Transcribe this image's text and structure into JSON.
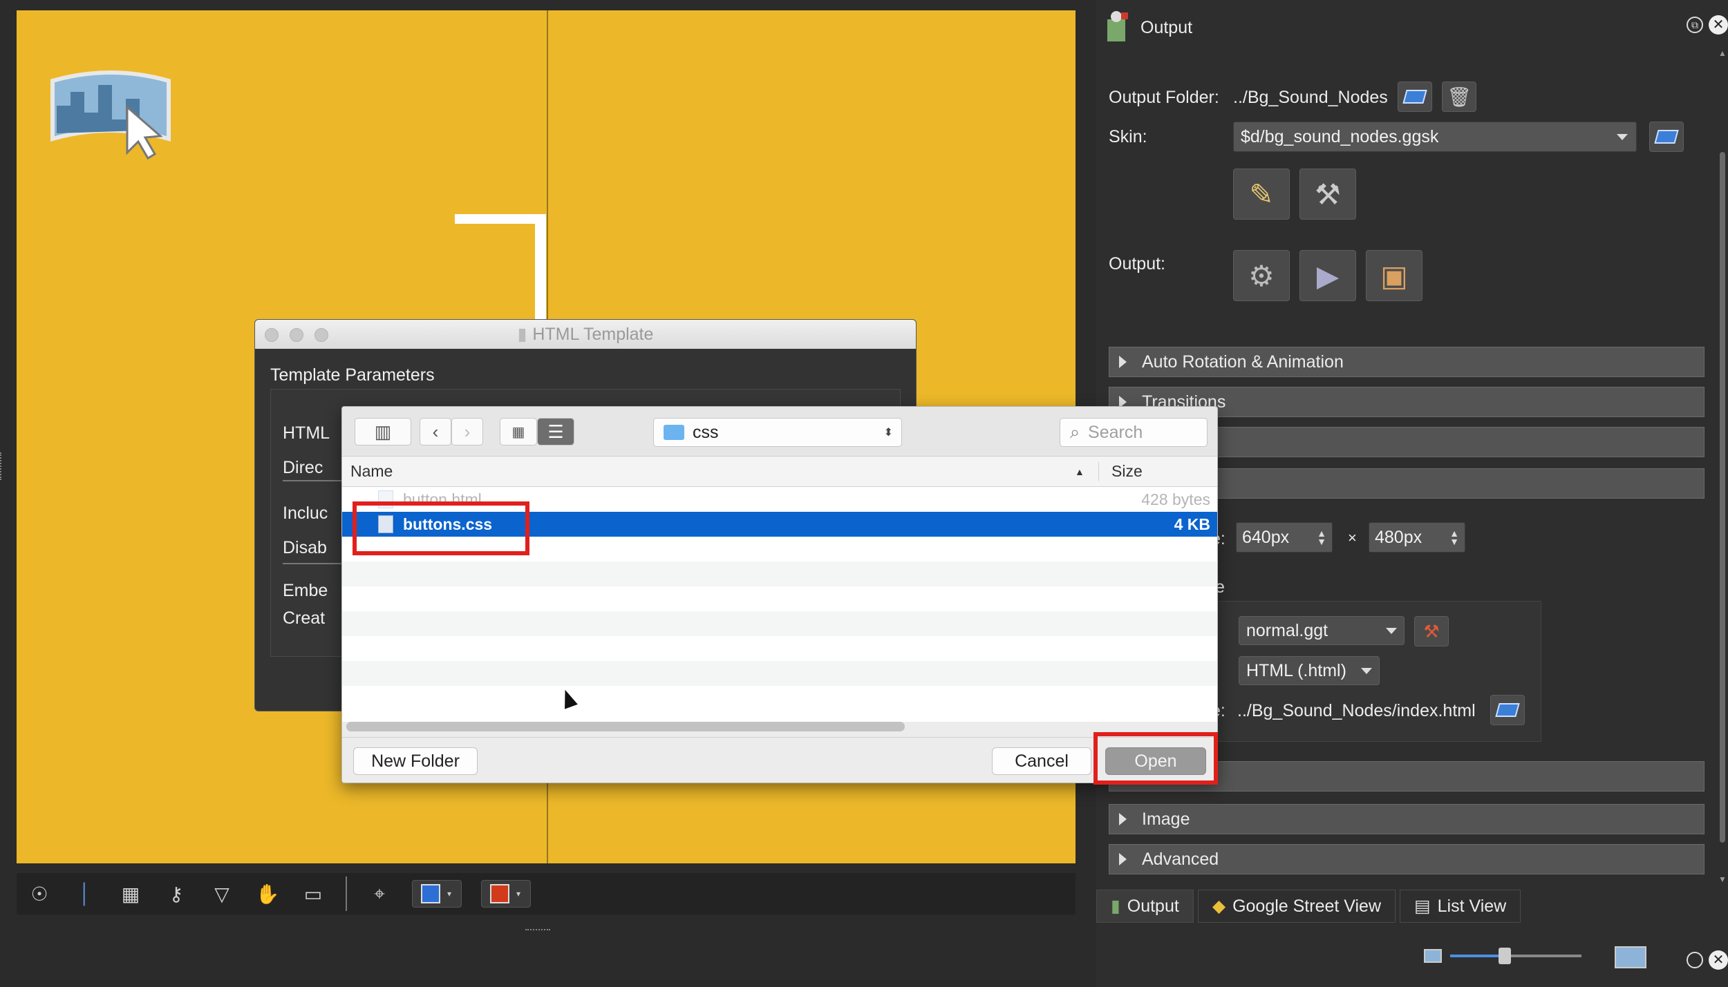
{
  "toolbar": {
    "icons": [
      "compass-icon",
      "crosshair-line-icon",
      "table-icon",
      "key-icon",
      "eye-cone-icon",
      "hand-icon",
      "panorama-icon",
      "target-icon"
    ],
    "color_fill": "#2e6fd6",
    "color_stroke": "#d23a1c"
  },
  "right_panel": {
    "title": "Output",
    "output_folder_label": "Output Folder:",
    "output_folder_value": "../Bg_Sound_Nodes",
    "skin_label": "Skin:",
    "skin_value": "$d/bg_sound_nodes.ggsk",
    "output_label": "Output:",
    "sections": [
      "Auto Rotation & Animation",
      "Transitions",
      "",
      "",
      "Image",
      "Advanced"
    ],
    "size_suffix": "e:",
    "width_value": "640px",
    "times": "×",
    "height_value": "480px",
    "partial_label_e": "e",
    "template_value": "normal.ggt",
    "format_value": "HTML (.html)",
    "file_label_suffix": "e:",
    "file_value": "../Bg_Sound_Nodes/index.html",
    "tabs": [
      "Output",
      "Google Street View",
      "List View"
    ]
  },
  "template_dialog": {
    "title": "HTML Template",
    "section_title": "Template Parameters",
    "labels": [
      "HTML",
      "Direc",
      "Incluc",
      "Disab",
      "Embe",
      "Creat"
    ]
  },
  "file_dialog": {
    "path": "css",
    "search_placeholder": "Search",
    "col_name": "Name",
    "col_size": "Size",
    "files": [
      {
        "name": "button.html",
        "size": "428 bytes"
      },
      {
        "name": "buttons.css",
        "size": "4 KB"
      }
    ],
    "new_folder": "New Folder",
    "cancel": "Cancel",
    "open": "Open"
  }
}
